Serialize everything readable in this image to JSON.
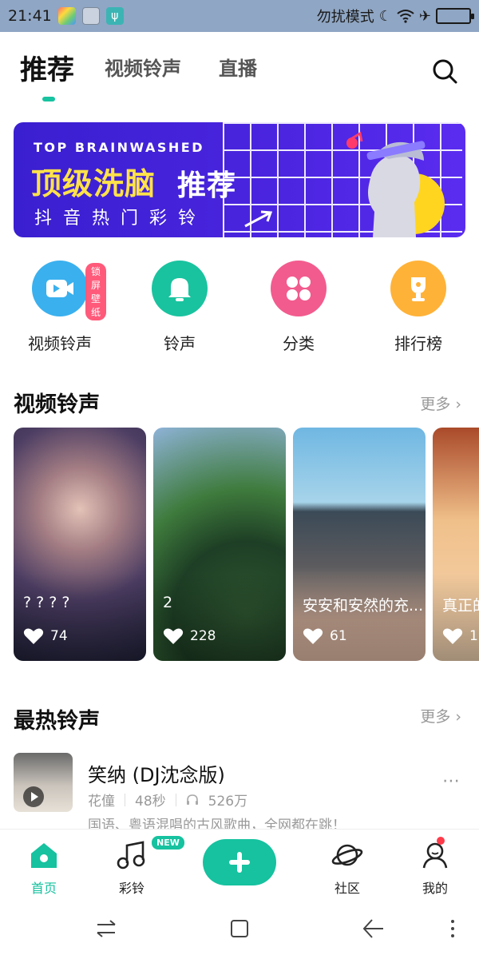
{
  "status_bar": {
    "time": "21:41",
    "dnd_text": "勿扰模式"
  },
  "top_tabs": [
    {
      "label": "推荐",
      "active": true
    },
    {
      "label": "视频铃声",
      "active": false
    },
    {
      "label": "直播",
      "active": false
    }
  ],
  "banner": {
    "subtitle": "TOP BRAINWASHED",
    "title_highlight": "顶级洗脑",
    "title_rest": "推荐",
    "tagline": "抖音热门彩铃"
  },
  "quick_entries": [
    {
      "label": "视频铃声",
      "badge": "锁屏壁纸",
      "color": "#3ab0ee",
      "icon": "video-icon"
    },
    {
      "label": "铃声",
      "color": "#19c39f",
      "icon": "bell-icon"
    },
    {
      "label": "分类",
      "color": "#f25b8e",
      "icon": "category-icon"
    },
    {
      "label": "排行榜",
      "color": "#ffb238",
      "icon": "trophy-icon"
    }
  ],
  "video_section": {
    "title": "视频铃声",
    "more": "更多 ›",
    "cards": [
      {
        "title": "? ? ? ?",
        "likes": "74"
      },
      {
        "title": "2",
        "likes": "228"
      },
      {
        "title": "安安和安然的充...",
        "likes": "61"
      },
      {
        "title": "真正的",
        "likes": "1"
      }
    ]
  },
  "hot_section": {
    "title": "最热铃声",
    "more": "更多 ›",
    "songs": [
      {
        "title": "笑纳 (DJ沈念版)",
        "artist": "花僮",
        "duration": "48秒",
        "plays": "526万",
        "desc": "国语、粤语混唱的古风歌曲，全网都在跳！"
      }
    ]
  },
  "bottom_nav": [
    {
      "label": "首页",
      "active": true
    },
    {
      "label": "彩铃",
      "badge": "NEW"
    },
    {
      "label": "社区"
    },
    {
      "label": "我的"
    }
  ],
  "colors": {
    "accent": "#16c29f",
    "banner": "#4b25e0",
    "banner_highlight": "#ffe24a"
  }
}
